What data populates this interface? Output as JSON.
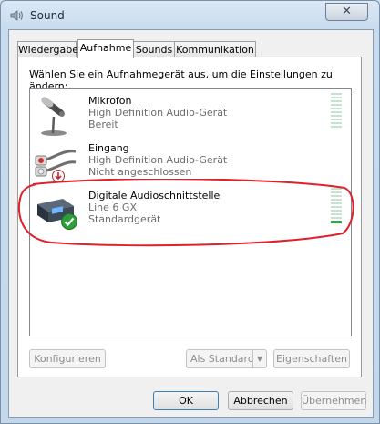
{
  "window": {
    "title": "Sound",
    "close_symbol": "✕"
  },
  "tabs": [
    {
      "label": "Wiedergabe",
      "active": false
    },
    {
      "label": "Aufnahme",
      "active": true
    },
    {
      "label": "Sounds",
      "active": false
    },
    {
      "label": "Kommunikation",
      "active": false
    }
  ],
  "instruction": "Wählen Sie ein Aufnahmegerät aus, um die Einstellungen zu ändern:",
  "devices": [
    {
      "name": "Mikrofon",
      "type": "High Definition Audio-Gerät",
      "status": "Bereit",
      "icon": "microphone-icon",
      "status_icon": "none",
      "level": 0
    },
    {
      "name": "Eingang",
      "type": "High Definition Audio-Gerät",
      "status": "Nicht angeschlossen",
      "icon": "cable-connector-icon",
      "status_icon": "disconnected-arrow-icon",
      "level": 0
    },
    {
      "name": "Digitale Audioschnittstelle",
      "type": "Line 6 GX",
      "status": "Standardgerät",
      "icon": "audio-interface-icon",
      "status_icon": "default-checkmark-icon",
      "level": 0.05
    }
  ],
  "buttons": {
    "configure": "Konfigurieren",
    "set_default": "Als Standard",
    "properties": "Eigenschaften",
    "ok": "OK",
    "cancel": "Abbrechen",
    "apply": "Übernehmen"
  },
  "colors": {
    "annotation_red": "#e0202a",
    "meter_green": "#2fa64a",
    "meter_inactive": "#c6e3cf"
  }
}
